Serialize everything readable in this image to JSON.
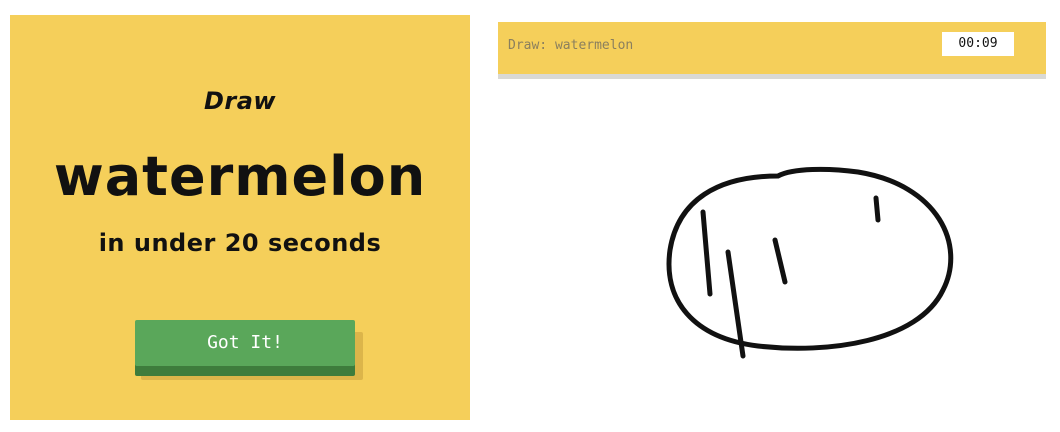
{
  "instructions": {
    "line1": "Draw",
    "subject": "watermelon",
    "line3": "in under 20 seconds",
    "button_label": "Got It!"
  },
  "game": {
    "prompt": "Draw: watermelon",
    "timer": "00:09"
  },
  "colors": {
    "card_bg": "#f5cf5a",
    "button": "#5aa75a",
    "button_edge": "#3e7c3c",
    "ink": "#111111"
  }
}
